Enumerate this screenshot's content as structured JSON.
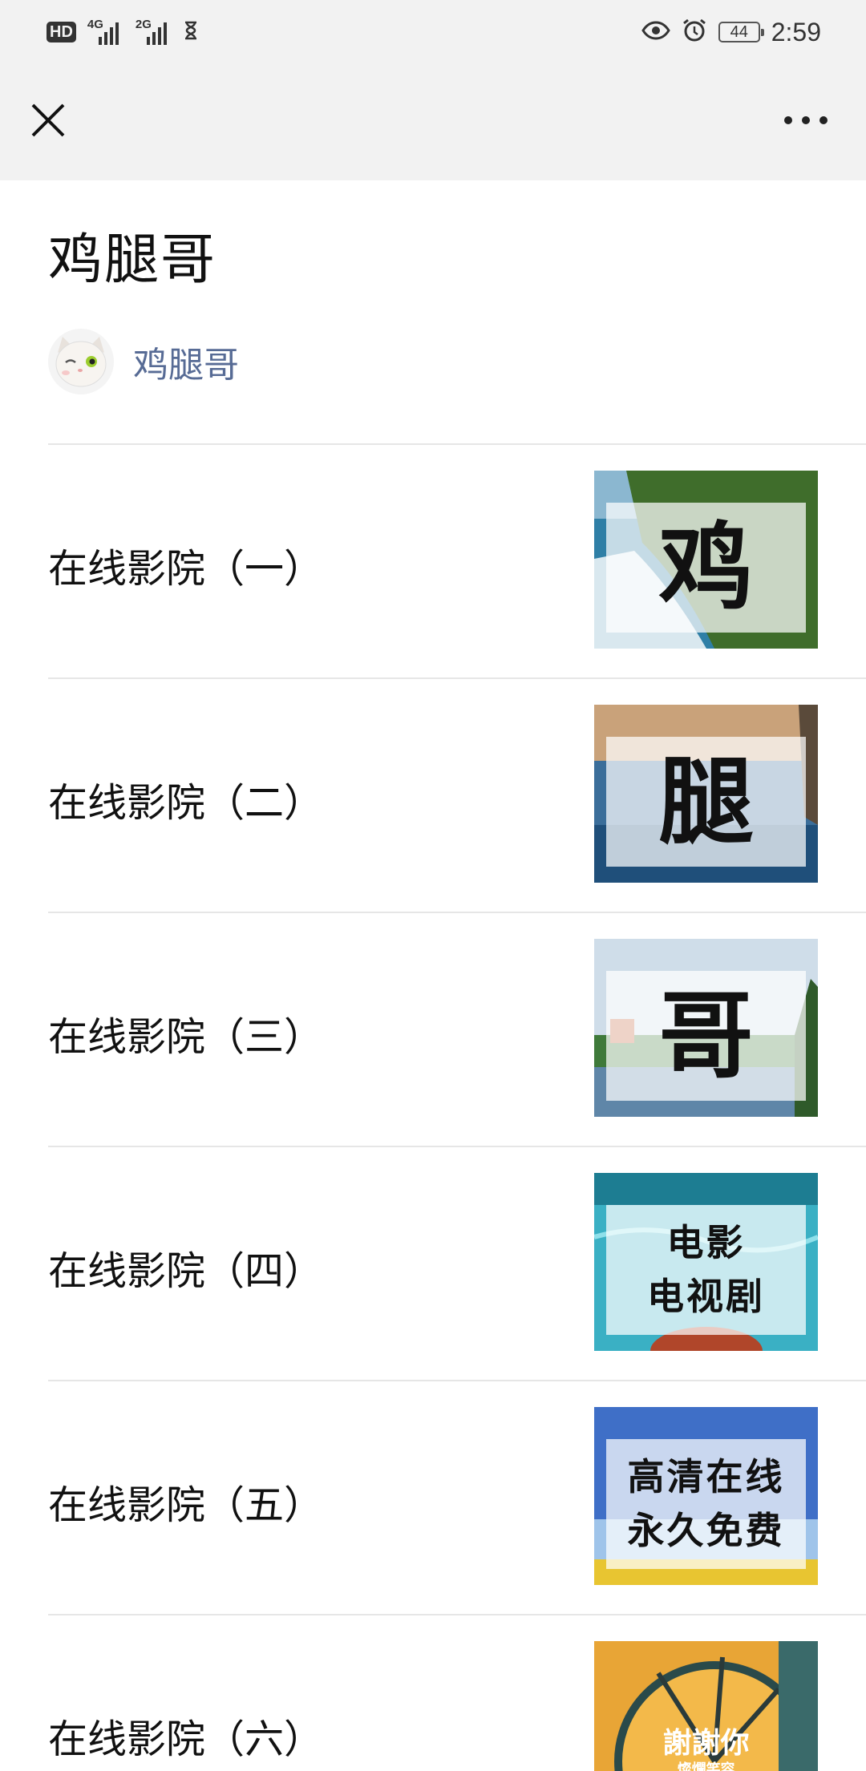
{
  "status": {
    "hd": "HD",
    "net1": "4G",
    "net2": "2G",
    "battery": "44",
    "time": "2:59"
  },
  "article": {
    "title": "鸡腿哥",
    "author": "鸡腿哥"
  },
  "items": [
    {
      "label": "在线影院（一）",
      "thumb_text": "鸡"
    },
    {
      "label": "在线影院（二）",
      "thumb_text": "腿"
    },
    {
      "label": "在线影院（三）",
      "thumb_text": "哥"
    },
    {
      "label": "在线影院（四）",
      "thumb_line1": "电影",
      "thumb_line2": "电视剧"
    },
    {
      "label": "在线影院（五）",
      "thumb_line1": "高清在线",
      "thumb_line2": "永久免费"
    },
    {
      "label": "在线影院（六）",
      "thumb_title": "謝謝你",
      "thumb_sub1": "燦爛笑容"
    }
  ],
  "colors": {
    "link": "#576b95",
    "toolbar_bg": "#f2f2f2",
    "divider": "#e6e6e6"
  },
  "icons": {
    "close": "close-icon",
    "more": "more-icon",
    "eye": "eye-icon",
    "alarm": "alarm-icon",
    "hourglass": "hourglass-icon"
  }
}
